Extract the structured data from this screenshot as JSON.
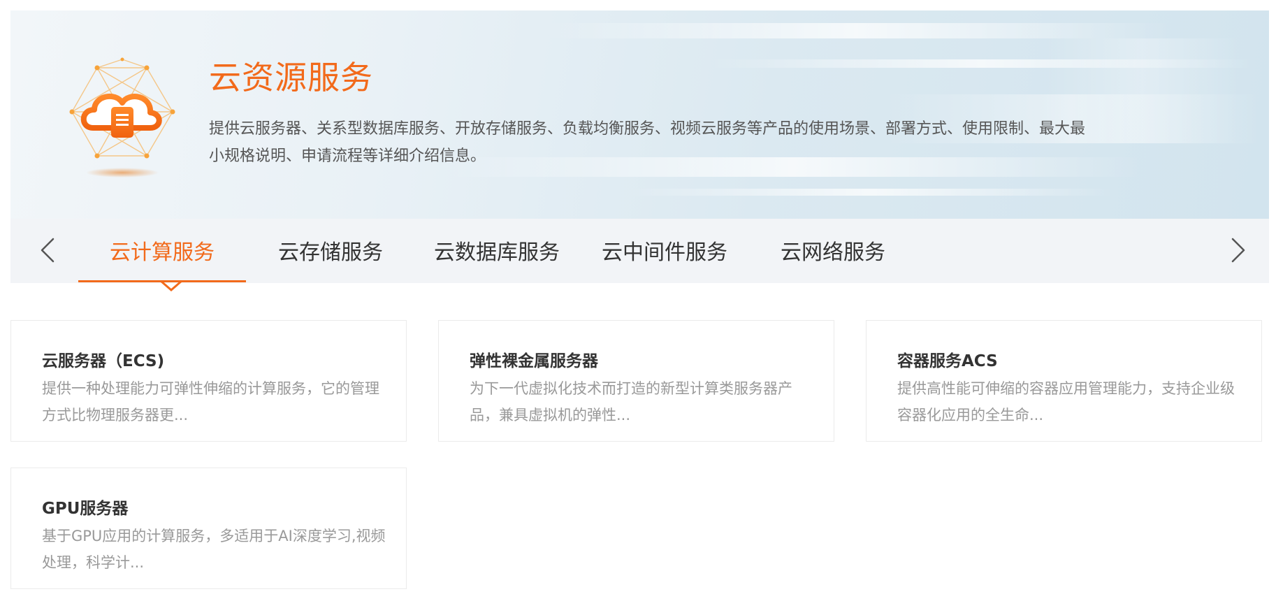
{
  "banner": {
    "title": "云资源服务",
    "description": "提供云服务器、关系型数据库服务、开放存储服务、负载均衡服务、视频云服务等产品的使用场景、部署方式、使用限制、最大最小规格说明、申请流程等详细介绍信息。",
    "logo_icon": "cloud-server-icon",
    "accent_color": "#f26a1b"
  },
  "tabs": {
    "prev_icon": "chevron-left-icon",
    "next_icon": "chevron-right-icon",
    "items": [
      {
        "label": "云计算服务",
        "active": true
      },
      {
        "label": "云存储服务",
        "active": false
      },
      {
        "label": "云数据库服务",
        "active": false
      },
      {
        "label": "云中间件服务",
        "active": false
      },
      {
        "label": "云网络服务",
        "active": false
      }
    ]
  },
  "cards": [
    {
      "title": "云服务器（ECS)",
      "description": "提供一种处理能力可弹性伸缩的计算服务，它的管理方式比物理服务器更..."
    },
    {
      "title": "弹性裸金属服务器",
      "description": "为下一代虚拟化技术而打造的新型计算类服务器产品，兼具虚拟机的弹性..."
    },
    {
      "title": "容器服务ACS",
      "description": "提供高性能可伸缩的容器应用管理能力，支持企业级容器化应用的全生命..."
    },
    {
      "title": "GPU服务器",
      "description": "基于GPU应用的计算服务，多适用于AI深度学习,视频处理，科学计..."
    }
  ]
}
